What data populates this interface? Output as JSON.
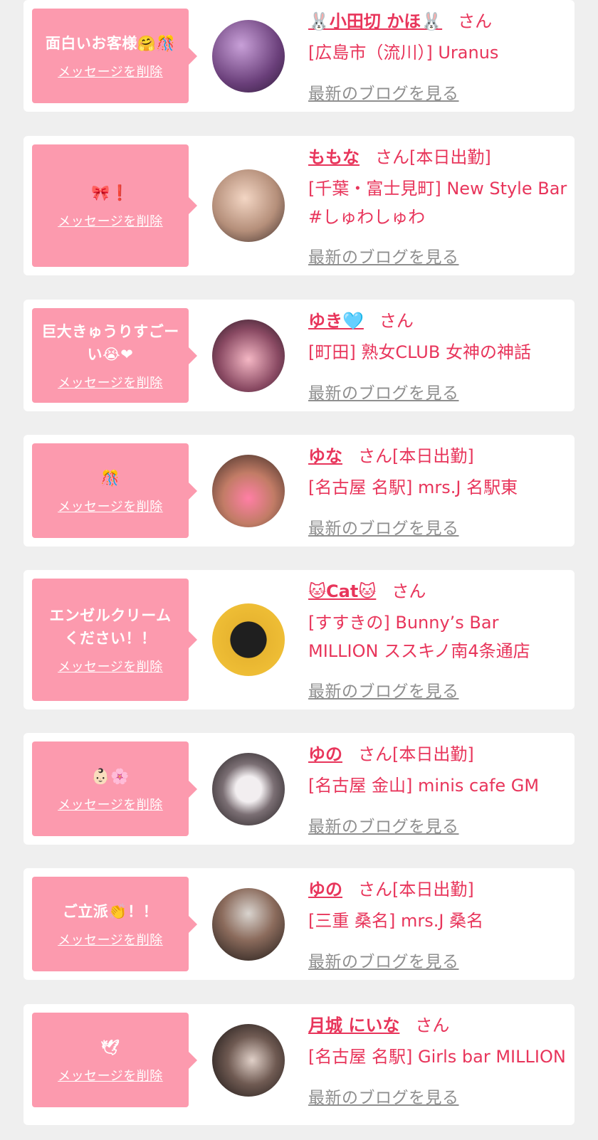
{
  "colors": {
    "page_bg": "#efefef",
    "card_bg": "#ffffff",
    "bubble_bg": "#fc9aae",
    "accent_pink": "#e8355b",
    "link_gray": "#8f8f8f"
  },
  "common": {
    "delete_label": "メッセージを削除",
    "blog_label": "最新のブログを見る",
    "san_label": "さん"
  },
  "items": [
    {
      "message": "面白いお客様🤗🎊",
      "name": "🐰小田切 かほ🐰",
      "suffix": "",
      "shop": "[広島市（流川）] Uranus",
      "avatar_icon": "photo-avatar-icon"
    },
    {
      "message": "🎀❗",
      "name": "ももな",
      "suffix": "[本日出勤]",
      "shop": "[千葉・富士見町] New Style Bar #しゅわしゅわ",
      "avatar_icon": "photo-avatar-icon"
    },
    {
      "message": "巨大きゅうりすごーい😭❤",
      "name": "ゆき🩵",
      "suffix": "",
      "shop": "[町田] 熟女CLUB 女神の神話",
      "avatar_icon": "photo-avatar-icon"
    },
    {
      "message": "🎊",
      "name": "ゆな",
      "suffix": "[本日出勤]",
      "shop": "[名古屋 名駅] mrs.J 名駅東",
      "avatar_icon": "photo-avatar-icon"
    },
    {
      "message": "エンゼルクリームください！！",
      "name": "🐱Cat🐱",
      "suffix": "",
      "shop": "[すすきの] Bunny’s Bar MILLION ススキノ南4条通店",
      "avatar_icon": "photo-avatar-icon"
    },
    {
      "message": "👶🏻🌸",
      "name": "ゆの",
      "suffix": "[本日出勤]",
      "shop": "[名古屋 金山] minis cafe GM",
      "avatar_icon": "photo-avatar-icon"
    },
    {
      "message": "ご立派👏！！",
      "name": "ゆの",
      "suffix": "[本日出勤]",
      "shop": "[三重 桑名] mrs.J 桑名",
      "avatar_icon": "photo-avatar-icon"
    },
    {
      "message": "🕊",
      "name": "月城 にいな",
      "suffix": "",
      "shop": "[名古屋 名駅] Girls bar MILLION",
      "avatar_icon": "photo-avatar-icon"
    }
  ]
}
